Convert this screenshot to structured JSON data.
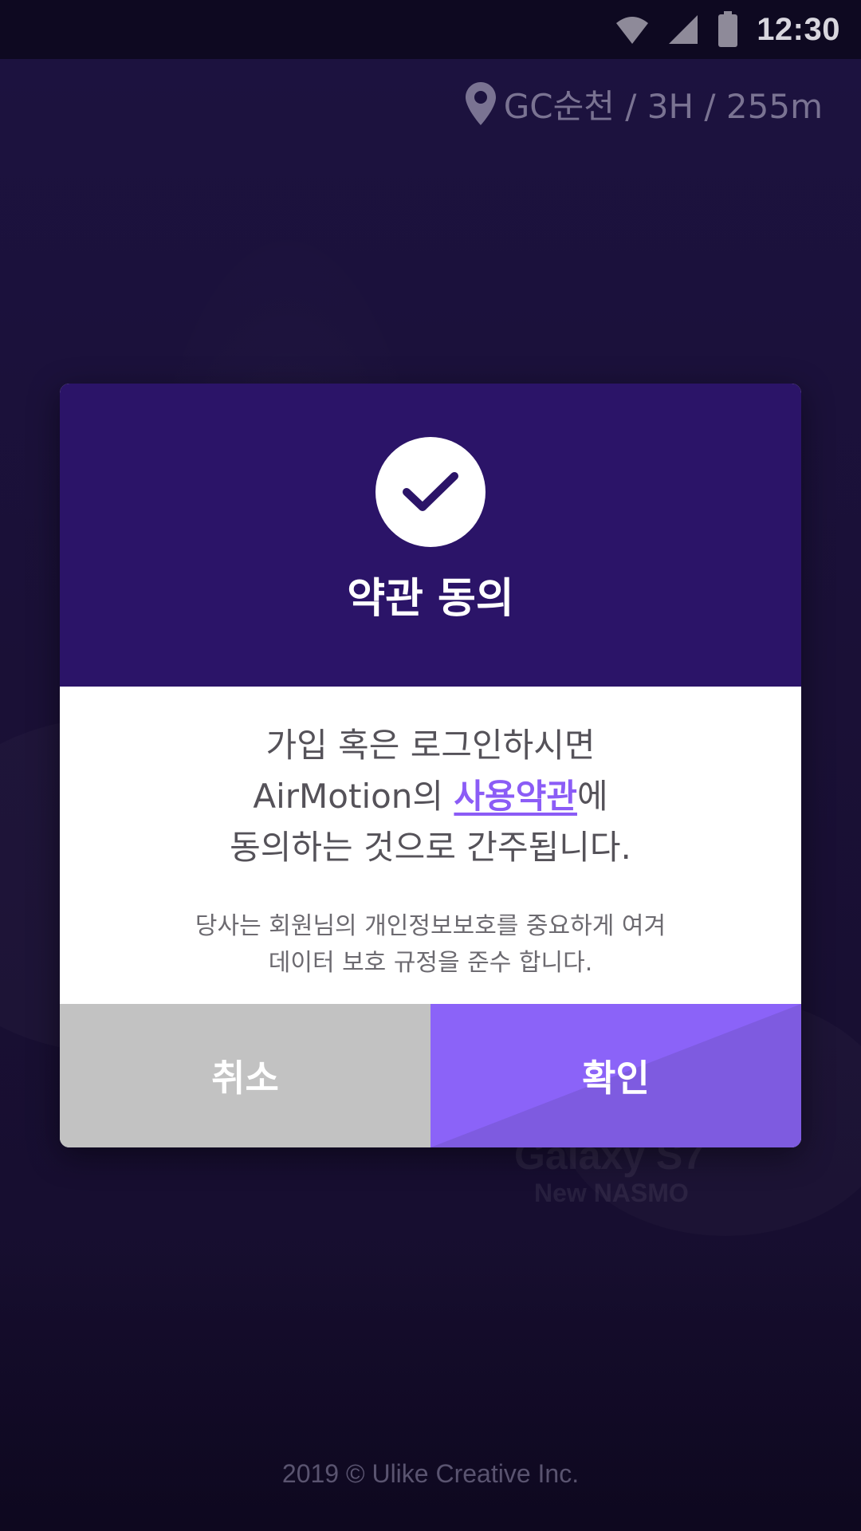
{
  "status_bar": {
    "time": "12:30",
    "icons": [
      "wifi-icon",
      "cell-signal-icon",
      "battery-icon"
    ]
  },
  "location": {
    "icon": "map-pin-icon",
    "text": "GC순천 / 3H / 255m"
  },
  "background": {
    "brand_line_1": "Galaxy S7",
    "brand_line_2": "New NASMO"
  },
  "dialog": {
    "icon": "check-icon",
    "title": "약관 동의",
    "message_line_1": "가입 혹은 로그인하시면",
    "message_line_2_prefix": "AirMotion의 ",
    "terms_link": "사용약관",
    "message_line_2_suffix": "에",
    "message_line_3": "동의하는 것으로 간주됩니다.",
    "sub_line_1": "당사는 회원님의 개인정보보호를 중요하게 여겨",
    "sub_line_2": "데이터 보호 규정을 준수 합니다.",
    "cancel_label": "취소",
    "confirm_label": "확인"
  },
  "colors": {
    "header_purple": "#2b1468",
    "accent": "#8b5cf6",
    "confirm_button": "#8b63f8",
    "cancel_button": "#c2c2c2"
  },
  "footer": {
    "copyright": "2019 © Ulike Creative Inc."
  }
}
